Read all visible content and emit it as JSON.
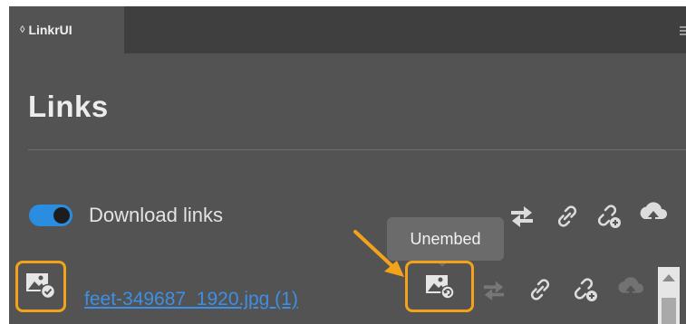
{
  "panel": {
    "tab_label": "LinkrUI",
    "tab_chevron": "◊",
    "menu_icon": "hamburger-menu-icon"
  },
  "header": {
    "title": "Links"
  },
  "download": {
    "label": "Download links",
    "enabled": true,
    "toolbar_icons": [
      "relink-icon",
      "link-icon",
      "unlink-icon",
      "upload-cloud-icon"
    ]
  },
  "tooltip": {
    "text": "Unembed"
  },
  "row": {
    "filename": "feet-349687_1920.jpg (1)",
    "status_icon": "embedded-image-icon",
    "action_icons": [
      "unembed-icon",
      "relink-icon",
      "link-icon",
      "unlink-icon",
      "upload-cloud-icon"
    ]
  },
  "colors": {
    "panel_bg": "#535353",
    "accent_blue": "#2a8de0",
    "highlight_orange": "#f2a31a",
    "link_blue": "#3d8fe6"
  }
}
